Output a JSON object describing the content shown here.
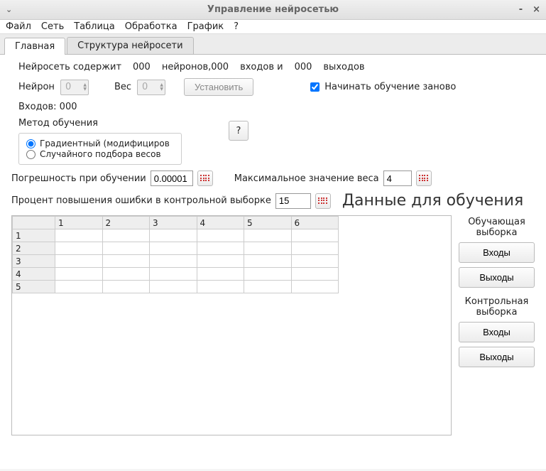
{
  "window": {
    "title": "Управление нейросетью"
  },
  "menu": {
    "file": "Файл",
    "net": "Сеть",
    "table": "Таблица",
    "process": "Обработка",
    "chart": "График",
    "help": "?"
  },
  "tabs": {
    "main": "Главная",
    "structure": "Структура нейросети"
  },
  "info": {
    "prefix": "Нейросеть содержит",
    "neurons_n": "000",
    "neurons_lbl": "нейронов,000",
    "inputs_lbl": "входов и",
    "outputs_n": "000",
    "outputs_lbl": "выходов"
  },
  "neuron": {
    "label": "Нейрон",
    "value": "0",
    "weight_label": "Вес",
    "weight_value": "0",
    "set_btn": "Установить"
  },
  "start_over": {
    "label": "Начинать обучение заново",
    "checked": true
  },
  "inputs_line": "Входов: 000",
  "method": {
    "label": "Метод обучения",
    "opt1": "Градиентный (модифициров",
    "opt2": "Случайного подбора весов"
  },
  "error": {
    "label": "Погрешность при обучении",
    "value": "0.00001"
  },
  "maxweight": {
    "label": "Максимальное значение веса",
    "value": "4"
  },
  "percent": {
    "label": "Процент повышения ошибки в контрольной выборке",
    "value": "15"
  },
  "train_heading": "Данные для обучения",
  "table": {
    "cols": [
      "1",
      "2",
      "3",
      "4",
      "5",
      "6"
    ],
    "rows": [
      "1",
      "2",
      "3",
      "4",
      "5"
    ]
  },
  "side": {
    "train_label": "Обучающая выборка",
    "inputs_btn": "Входы",
    "outputs_btn": "Выходы",
    "control_label": "Контрольная выборка"
  }
}
